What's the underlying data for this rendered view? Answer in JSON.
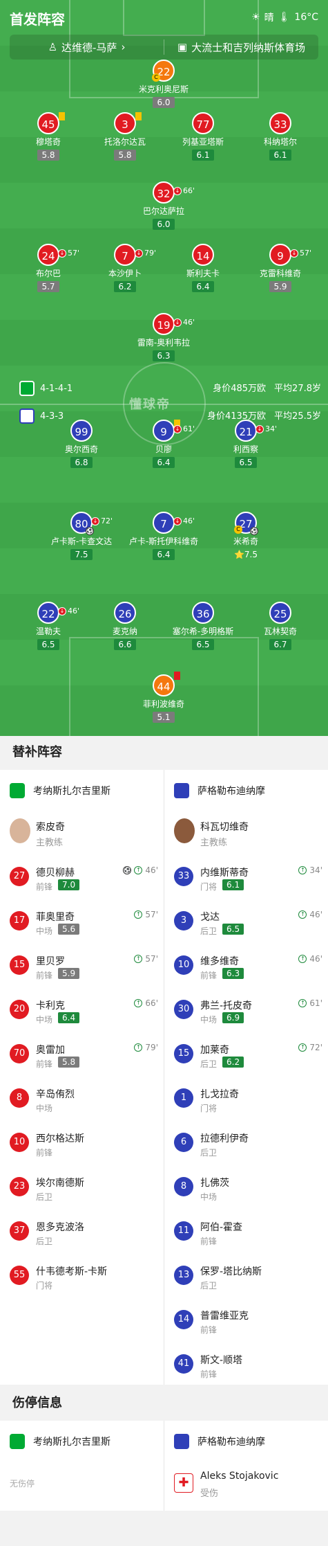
{
  "header": {
    "title": "首发阵容",
    "weather": "晴",
    "temp": "16°C"
  },
  "venue": {
    "team": "达维德-马萨",
    "team_arrow": "›",
    "stadium": "大流士和吉列纳斯体育场"
  },
  "home": {
    "formation": "4-1-4-1",
    "value": "身价485万欧",
    "age": "平均27.8岁"
  },
  "away": {
    "formation": "4-3-3",
    "value": "身价4135万欧",
    "age": "平均25.5岁"
  },
  "watermark": "懂球帝",
  "players": [
    {
      "num": "22",
      "name": "米克利奥尼斯",
      "rating": "6.0",
      "color": "orange",
      "rc": "grey",
      "cap": true
    },
    {
      "num": "45",
      "name": "穆塔奇",
      "rating": "5.8",
      "color": "red",
      "rc": "grey",
      "yc": true
    },
    {
      "num": "3",
      "name": "托洛尔达瓦",
      "rating": "5.8",
      "color": "red",
      "rc": "grey",
      "yc": true
    },
    {
      "num": "77",
      "name": "列基亚塔斯",
      "rating": "6.1",
      "color": "red",
      "rc": "green"
    },
    {
      "num": "33",
      "name": "科纳塔尔",
      "rating": "6.1",
      "color": "red",
      "rc": "green"
    },
    {
      "num": "32",
      "name": "巴尔达萨拉",
      "rating": "6.0",
      "color": "red",
      "rc": "green",
      "sub": "66'"
    },
    {
      "num": "24",
      "name": "布尔巴",
      "rating": "5.7",
      "color": "red",
      "rc": "grey",
      "sub": "57'"
    },
    {
      "num": "7",
      "name": "本沙伊卜",
      "rating": "6.2",
      "color": "red",
      "rc": "green",
      "sub": "79'"
    },
    {
      "num": "14",
      "name": "斯利夫卡",
      "rating": "6.4",
      "color": "red",
      "rc": "green"
    },
    {
      "num": "9",
      "name": "克雷科维奇",
      "rating": "5.9",
      "color": "red",
      "rc": "grey",
      "sub": "57'"
    },
    {
      "num": "19",
      "name": "雷南-奥利韦拉",
      "rating": "6.3",
      "color": "red",
      "rc": "green",
      "sub": "46'"
    },
    {
      "num": "99",
      "name": "奥尔西奇",
      "rating": "6.8",
      "color": "blue",
      "rc": "green"
    },
    {
      "num": "9",
      "name": "贝廖",
      "rating": "6.4",
      "color": "blue",
      "rc": "green",
      "sub": "61'",
      "yc": true
    },
    {
      "num": "21",
      "name": "利西察",
      "rating": "6.5",
      "color": "blue",
      "rc": "green",
      "sub": "34'"
    },
    {
      "num": "80",
      "name": "卢卡斯-卡查文达",
      "rating": "7.5",
      "color": "blue",
      "rc": "green",
      "sub": "72'",
      "ball": true
    },
    {
      "num": "7",
      "name": "卢卡-斯托伊科维奇",
      "rating": "6.4",
      "color": "blue",
      "rc": "green",
      "sub": "46'"
    },
    {
      "num": "27",
      "name": "米希奇",
      "rating": "⭐7.5",
      "color": "blue",
      "rc": "none",
      "cap": true,
      "ball": true
    },
    {
      "num": "22",
      "name": "温勒夫",
      "rating": "6.5",
      "color": "blue",
      "rc": "green",
      "sub": "46'"
    },
    {
      "num": "26",
      "name": "麦克纳",
      "rating": "6.6",
      "color": "blue",
      "rc": "green"
    },
    {
      "num": "36",
      "name": "塞尔希-多明格斯",
      "rating": "6.5",
      "color": "blue",
      "rc": "green"
    },
    {
      "num": "25",
      "name": "瓦林契奇",
      "rating": "6.7",
      "color": "blue",
      "rc": "green"
    },
    {
      "num": "44",
      "name": "菲利波维奇",
      "rating": "5.1",
      "color": "orange",
      "rc": "grey",
      "rcard": true
    }
  ],
  "subs_title": "替补阵容",
  "home_team": "考纳斯扎尔吉里斯",
  "away_team": "萨格勒布迪纳摩",
  "home_coach": {
    "name": "索皮奇",
    "role": "主教练"
  },
  "away_coach": {
    "name": "科瓦切维奇",
    "role": "主教练"
  },
  "home_subs": [
    {
      "num": "27",
      "name": "德贝柳赫",
      "pos": "前锋",
      "rating": "7.0",
      "rc": "green",
      "time": "46'",
      "goal": true
    },
    {
      "num": "17",
      "name": "菲奥里奇",
      "pos": "中场",
      "rating": "5.6",
      "rc": "grey",
      "time": "57'"
    },
    {
      "num": "15",
      "name": "里贝罗",
      "pos": "前锋",
      "rating": "5.9",
      "rc": "grey",
      "time": "57'"
    },
    {
      "num": "20",
      "name": "卡利克",
      "pos": "中场",
      "rating": "6.4",
      "rc": "green",
      "time": "66'"
    },
    {
      "num": "70",
      "name": "奥雷加",
      "pos": "前锋",
      "rating": "5.8",
      "rc": "grey",
      "time": "79'"
    },
    {
      "num": "8",
      "name": "辛岛侑烈",
      "pos": "中场"
    },
    {
      "num": "10",
      "name": "西尔格达斯",
      "pos": "前锋"
    },
    {
      "num": "23",
      "name": "埃尔南德斯",
      "pos": "后卫"
    },
    {
      "num": "37",
      "name": "恩多克波洛",
      "pos": "后卫"
    },
    {
      "num": "55",
      "name": "什韦德考斯-卡斯",
      "pos": "门将"
    }
  ],
  "away_subs": [
    {
      "num": "33",
      "name": "内维斯蒂奇",
      "pos": "门将",
      "rating": "6.1",
      "rc": "green",
      "time": "34'"
    },
    {
      "num": "3",
      "name": "戈达",
      "pos": "后卫",
      "rating": "6.5",
      "rc": "green",
      "time": "46'"
    },
    {
      "num": "10",
      "name": "维多维奇",
      "pos": "前锋",
      "rating": "6.3",
      "rc": "green",
      "time": "46'"
    },
    {
      "num": "30",
      "name": "弗兰-托皮奇",
      "pos": "中场",
      "rating": "6.9",
      "rc": "green",
      "time": "61'"
    },
    {
      "num": "15",
      "name": "加莱奇",
      "pos": "后卫",
      "rating": "6.2",
      "rc": "green",
      "time": "72'"
    },
    {
      "num": "1",
      "name": "扎戈拉奇",
      "pos": "门将"
    },
    {
      "num": "6",
      "name": "拉德利伊奇",
      "pos": "后卫"
    },
    {
      "num": "8",
      "name": "扎佛茨",
      "pos": "中场"
    },
    {
      "num": "11",
      "name": "阿伯-霍查",
      "pos": "前锋"
    },
    {
      "num": "13",
      "name": "保罗-塔比纳斯",
      "pos": "后卫"
    },
    {
      "num": "14",
      "name": "普雷维亚克",
      "pos": "前锋"
    },
    {
      "num": "41",
      "name": "斯文-顺塔",
      "pos": "前锋"
    }
  ],
  "injury_title": "伤停信息",
  "home_injury": "无伤停",
  "away_injury": {
    "name": "Aleks Stojakovic",
    "status": "受伤"
  },
  "colors": {
    "pitch": "#3fa64a",
    "home": "#e11b22",
    "away": "#2f3fb8",
    "keeper": "#f4780e"
  }
}
